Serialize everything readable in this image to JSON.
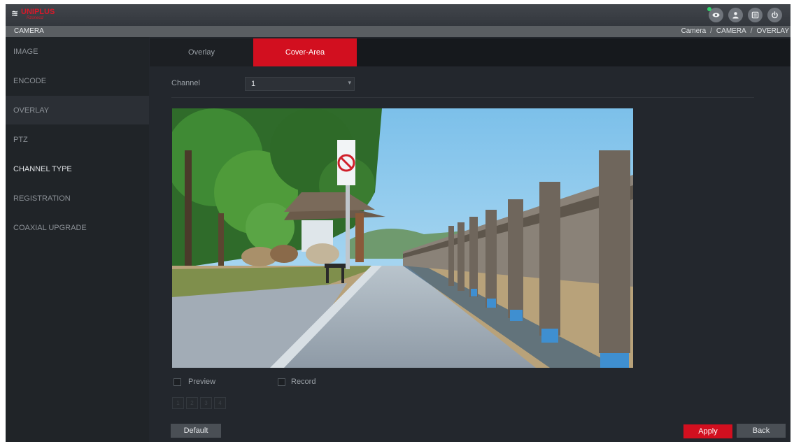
{
  "header": {
    "logo_brand": "UNIPLUS",
    "logo_sub": "Rzonecd",
    "title": "CAMERA"
  },
  "breadcrumb": [
    "Camera",
    "CAMERA",
    "OVERLAY"
  ],
  "breadcrumb_sep": "/",
  "icons": {
    "live": "eye-icon",
    "account": "user-icon",
    "menu": "menu-icon",
    "power": "power-icon"
  },
  "sidebar": {
    "items": [
      {
        "label": "IMAGE"
      },
      {
        "label": "ENCODE"
      },
      {
        "label": "OVERLAY"
      },
      {
        "label": "PTZ"
      },
      {
        "label": "CHANNEL TYPE"
      },
      {
        "label": "REGISTRATION"
      },
      {
        "label": "COAXIAL UPGRADE"
      }
    ]
  },
  "tabs": [
    {
      "label": "Overlay"
    },
    {
      "label": "Cover-Area"
    }
  ],
  "channel": {
    "label": "Channel",
    "value": "1"
  },
  "options": {
    "preview_label": "Preview",
    "record_label": "Record"
  },
  "regions": [
    "1",
    "2",
    "3",
    "4"
  ],
  "buttons": {
    "default": "Default",
    "apply": "Apply",
    "back": "Back"
  },
  "colors": {
    "accent": "#d20f1f",
    "background": "#23272d",
    "sidebar": "#202428",
    "status_online": "#2fd36a"
  }
}
